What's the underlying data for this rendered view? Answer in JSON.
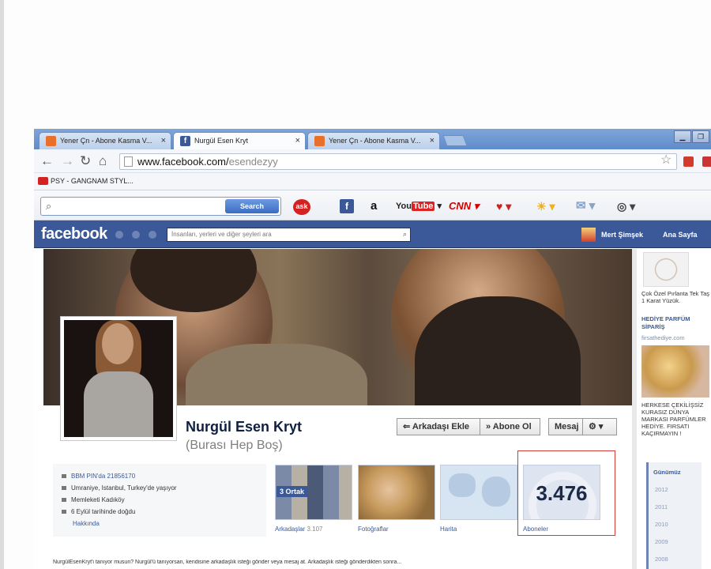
{
  "tabs": [
    {
      "label": "Yener Çn - Abone Kasma V..."
    },
    {
      "label": "Nurgül Esen Kryt"
    },
    {
      "label": "Yener Çn - Abone Kasma V..."
    }
  ],
  "address": {
    "host": "www.facebook.com/",
    "path": "esendezyy"
  },
  "bookmark": {
    "label": "PSY - GANGNAM STYL..."
  },
  "toolbar": {
    "search_button": "Search",
    "ask": "ask",
    "youtube_you": "You",
    "youtube_tube": "Tube",
    "cnn": "CNN"
  },
  "fb": {
    "logo": "facebook",
    "search_placeholder": "İnsanları, yerleri ve diğer şeyleri ara",
    "user": "Mert Şimşek",
    "home": "Ana Sayfa"
  },
  "profile": {
    "name": "Nurgül Esen Kryt",
    "subtitle": "(Burası Hep Boş)",
    "add_friend": "Arkadaşı Ekle",
    "subscribe": "Abone Ol",
    "message": "Mesaj",
    "settings": "⚙ ▾"
  },
  "info": {
    "bbm": "BBM PIN'da 21856170",
    "lives": "Umraniye, Istanbul, Turkey'de yaşıyor",
    "hometown": "Memleketi Kadıköy",
    "birthday": "6 Eylül tarihinde doğdu",
    "about": "Hakkında"
  },
  "thumbs": {
    "friends_badge": "3 Ortak",
    "friends_label": "Arkadaşlar",
    "friends_count": "3.107",
    "photos_label": "Fotoğraflar",
    "map_label": "Harita",
    "subs_count": "3.476",
    "subs_label": "Aboneler"
  },
  "sidebar": {
    "ad1_text": "Çok Özel Pırlanta Tek Taş 1 Karat Yüzük.",
    "ad2_title": "HEDİYE PARFÜM SİPARİŞ",
    "ad2_url": "firsathediye.com",
    "ad2_text": "HERKESE ÇEKİLİŞSİZ KURASIZ DÜNYA MARKASI PARFÜMLER HEDİYE. FIRSATI KAÇIRMAYIN !",
    "timeline_now": "Günümüz",
    "years": [
      "2012",
      "2011",
      "2010",
      "2009",
      "2008"
    ]
  },
  "bottom_text": "NurgülEsenKryt'i tanıyor musun? Nurgül'ü tanıyorsan, kendisine arkadaşlık isteği gönder veya mesaj at. Arkadaşlık isteği gönderdikten sonra..."
}
